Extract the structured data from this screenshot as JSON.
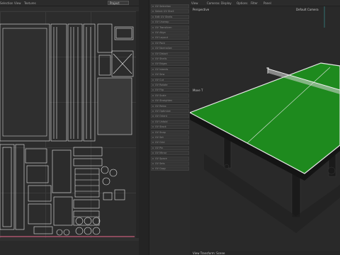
{
  "uv_editor": {
    "menu": [
      "Selection",
      "View",
      "Textures"
    ],
    "dropdown_value": "Project"
  },
  "side_panel": {
    "items": [
      "UV Selection",
      "Select UV Shell",
      "Edit UV Shells",
      "UV Unwrap",
      "UV Transform",
      "UV Align",
      "UV Layout",
      "UV Pack",
      "UV Normalize",
      "UV Distort",
      "UV Shells",
      "UV Edges",
      "UV Islands",
      "UV Sew",
      "UV Cut",
      "UV Rotate",
      "UV Flip",
      "UV Scale",
      "UV Straighten",
      "UV Relax",
      "UV Optimize",
      "UV Orient",
      "UV Unfold",
      "UV Stack",
      "UV Snap",
      "UV Set",
      "UV Grid",
      "UV Pin",
      "UV Mirror",
      "UV Space",
      "UV Sets",
      "UV Copy"
    ]
  },
  "viewport": {
    "menu": [
      "View",
      "Cameras",
      "Display",
      "Options",
      "Filter",
      "Panel"
    ],
    "view_name": "Perspective",
    "camera": "Default Camera",
    "tool_label": "Move T",
    "status": "View Transform: Scene",
    "colors": {
      "table_top": "#1e8a1e",
      "table_frame": "#1a1a1a",
      "net": "#e8e8e8"
    }
  }
}
